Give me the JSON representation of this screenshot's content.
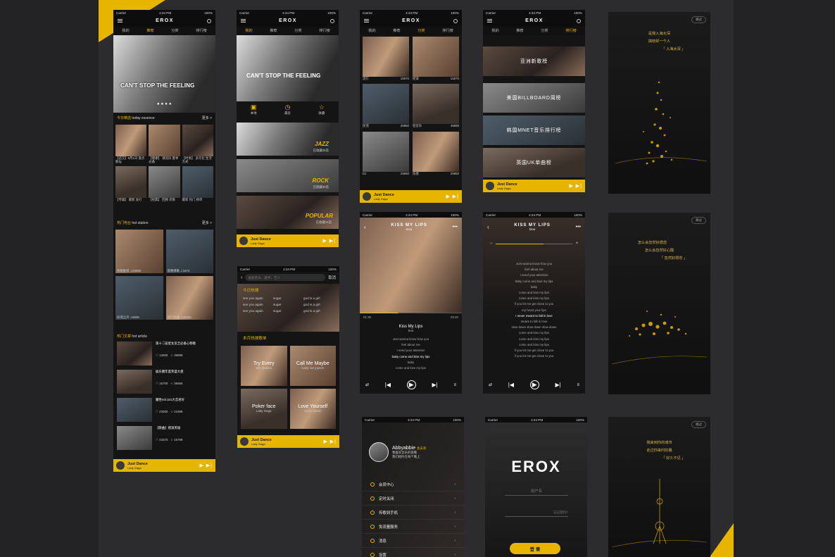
{
  "app": {
    "logo": "EROX",
    "carrier": "Carrier",
    "time": "4:34 PM",
    "battery": "100%"
  },
  "tabs": [
    "我的",
    "推荐",
    "分类",
    "排行榜"
  ],
  "player": {
    "song": "Just Dance",
    "artist": "Lady Gaga",
    "controls": "▶ ▶|"
  },
  "screen1": {
    "hero": "CAN'T STOP THE FEELING",
    "sec1": {
      "title": "今日精选",
      "sub": "today essence",
      "more": "更多 >"
    },
    "cards1": [
      "【武汉】9月1日 盘点歌坛",
      "【健康】 潮流风 夏季必备",
      "【时尚】 多元化 生活方式",
      "【专辑】 最新 发行",
      "【经典】 回顾 老歌",
      "最新 热门 榜单"
    ],
    "sec2": {
      "title": "热门电台",
      "sub": "hot station",
      "more": "更多 >"
    },
    "stations": [
      {
        "name": "热歌推荐",
        "count": "23895"
      },
      {
        "name": "夜晚情歌",
        "count": "1674"
      },
      {
        "name": "民谣之声",
        "count": "5695"
      },
      {
        "name": "流行金曲",
        "count": "26895"
      }
    ],
    "sec3": {
      "title": "热门文章",
      "sub": "hot article"
    },
    "articles": [
      {
        "title": "第十二届星女友全必备心物歌",
        "likes": "12000",
        "stars": "49899"
      },
      {
        "title": "娱乐圈年度奖盛大盘",
        "likes": "16700",
        "stars": "36666"
      },
      {
        "title": "魔性Vol.101大恋君好",
        "likes": "23300",
        "stars": "21688"
      },
      {
        "title": "【歌曲】摇滚英雄",
        "likes": "43370",
        "stars": "16789"
      }
    ]
  },
  "screen2": {
    "hero": "CAN'T STOP THE FEELING",
    "icons": [
      "本地",
      "最近",
      "收藏"
    ],
    "genres": [
      {
        "name": "JAZZ",
        "sub": "已收藏25首"
      },
      {
        "name": "ROCK",
        "sub": "已收藏30首"
      },
      {
        "name": "POPULAR",
        "sub": "已收藏15首"
      }
    ]
  },
  "screen3": {
    "categories": [
      {
        "name": "流行",
        "count": "15870"
      },
      {
        "name": "摇滚",
        "count": "15870"
      },
      {
        "name": "民谣",
        "count": "29850"
      },
      {
        "name": "轻音乐",
        "count": "49899"
      },
      {
        "name": "DJ",
        "count": "29850"
      },
      {
        "name": "伤感",
        "count": "29850"
      }
    ]
  },
  "screen4": {
    "charts": [
      "亚洲新歌榜",
      "美国BILLBOARD周榜",
      "韩国MNET音乐排行榜",
      "英国UK单曲榜"
    ]
  },
  "screen5": {
    "skip": "跳过",
    "quote": [
      "是我入海太深",
      "搞晓却一个人",
      "「 入海太深 」"
    ]
  },
  "screen6": {
    "search_placeholder": "搜索音乐、歌手、艺人",
    "cancel": "取消",
    "hot_title": "今日热搜",
    "hot": [
      [
        "see you again",
        "sugar",
        "god is a girl"
      ],
      [
        "see you again",
        "sugar",
        "god is a girl"
      ],
      [
        "see you again",
        "sugar",
        "god is a girl"
      ]
    ],
    "month_title": "本月热搜歌单",
    "playlists": [
      {
        "title": "Try Every",
        "artist": "Wly shakira"
      },
      {
        "title": "Call Me Maybe",
        "artist": "Carly rae jepsen"
      },
      {
        "title": "Poker face",
        "artist": "Lady Gaga"
      },
      {
        "title": "Love Yourself",
        "artist": "Justin bieber"
      }
    ]
  },
  "screen7": {
    "title": "KISS MY LIPS",
    "artist": "Boa",
    "elapsed": "01:35",
    "total": "03:40",
    "lyric_title": "Kiss My Lips",
    "lyric_artist": "Boa",
    "lyrics": [
      "Just wanna know how you",
      "feel about me",
      "I need your attention",
      "baby come and kiss my lips",
      "baby",
      "come and kiss my lips"
    ],
    "progress": 0.38
  },
  "screen8": {
    "title": "KISS MY LIPS",
    "artist": "Boa",
    "lyrics": [
      "Just wanna know how you",
      "feel about me",
      "I need your attention",
      "baby come and kiss my lips",
      "baby",
      "come and kiss my lips",
      "come and kiss my lips",
      "if you let me get close to you",
      "my heart your lips",
      "I never meant to fall in love",
      "meant to fall in love",
      "slow down slow down slow down",
      "come and kiss my lips",
      "come and kiss my lips",
      "come and kiss my lips",
      "if you let me get close to you",
      "if you let me get close to you"
    ],
    "volume": 0.62
  },
  "screen9": {
    "username": "Abbyabbie",
    "badge": "会员等",
    "bio": [
      "我喜欢音乐的夜晚",
      "我们相约在每个晚上"
    ],
    "menu": [
      "会员中心",
      "定时关闭",
      "传歌到手机",
      "免流量服务",
      "消息",
      "设置"
    ]
  },
  "screen10": {
    "logo": "EROX",
    "user_placeholder": "用户名",
    "password_placeholder": "忘记密码?",
    "login": "登 录"
  },
  "screen11": {
    "skip": "跳过",
    "quote": [
      "怎么会忽然好想念",
      "怎么会忽然好心酸",
      "「 忽然好想念 」"
    ]
  },
  "screen12": {
    "skip": "跳过",
    "quote": [
      "我来到你的城市",
      "走过你来时的路",
      "「 好久不见 」"
    ]
  },
  "colors": {
    "accent": "#e7b500",
    "background": "#232325",
    "phone": "#141414"
  }
}
